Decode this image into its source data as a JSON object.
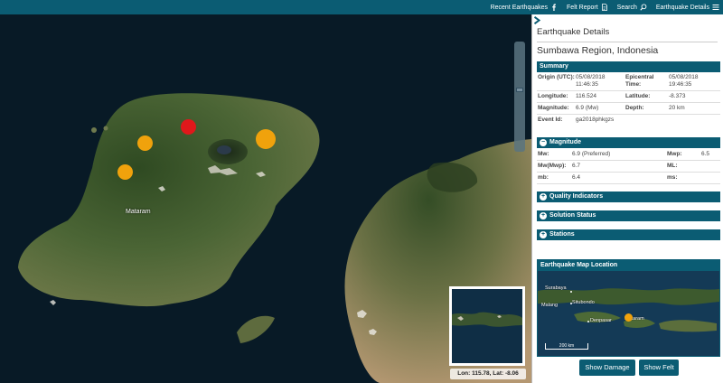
{
  "topnav": {
    "items": [
      {
        "label": "Recent Earthquakes",
        "icon": "facebook-icon"
      },
      {
        "label": "Felt Report",
        "icon": "document-icon"
      },
      {
        "label": "Search",
        "icon": "search-icon"
      },
      {
        "label": "Earthquake Details",
        "icon": "menu-icon"
      }
    ]
  },
  "map": {
    "city_label": "Mataram",
    "coords": "Lon: 115.78, Lat: -8.06",
    "quake_colors": {
      "red": "#e0181b",
      "orange": "#f0a20c"
    }
  },
  "panel": {
    "title": "Earthquake Details",
    "region": "Sumbawa Region, Indonesia",
    "summary": {
      "header": "Summary",
      "origin_label": "Origin (UTC):",
      "origin_value": "05/08/2018 11:46:35",
      "epicentral_label": "Epicentral Time:",
      "epicentral_value": "05/08/2018 19:46:35",
      "longitude_label": "Longitude:",
      "longitude_value": "116.524",
      "latitude_label": "Latitude:",
      "latitude_value": "-8.373",
      "magnitude_label": "Magnitude:",
      "magnitude_value": "6.9 (Mw)",
      "depth_label": "Depth:",
      "depth_value": "20 km",
      "event_label": "Event Id:",
      "event_value": "ga2018phkgzs"
    },
    "magnitude": {
      "header": "Magnitude",
      "mw_label": "Mw:",
      "mw_value": "6.9 (Preferred)",
      "mwp_label": "Mwp:",
      "mwp_value": "6.5",
      "mwmwp_label": "Mw(Mwp):",
      "mwmwp_value": "6.7",
      "ml_label": "ML:",
      "ml_value": "",
      "mb_label": "mb:",
      "mb_value": "6.4",
      "ms_label": "ms:",
      "ms_value": ""
    },
    "sections": [
      {
        "label": "Quality Indicators"
      },
      {
        "label": "Solution Status"
      },
      {
        "label": "Stations"
      }
    ],
    "mini_map": {
      "header": "Earthquake Map Location",
      "labels": [
        "Surabaya",
        "Situbondo",
        "Malang",
        "Denpasar",
        "Mataram"
      ],
      "scale": "200 km"
    },
    "buttons": {
      "damage": "Show Damage",
      "felt": "Show Felt"
    }
  }
}
